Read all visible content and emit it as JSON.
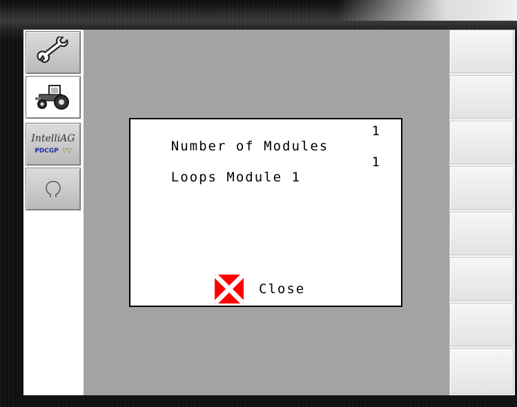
{
  "dialog": {
    "rows": [
      {
        "label": "Number of Modules",
        "value": "1"
      },
      {
        "label": "Loops Module 1",
        "value": "1"
      }
    ],
    "close_label": "Close"
  },
  "left_menu": {
    "items": [
      {
        "icon": "wrench-icon",
        "selected": false
      },
      {
        "icon": "tractor-icon",
        "selected": true
      },
      {
        "icon": "intelliag-logo",
        "selected": false,
        "logo_text": "IntelliAG",
        "logo_sub": "PDCGP",
        "logo_mark": "▽▽"
      },
      {
        "icon": "sprayer-nozzle-icon",
        "selected": false
      }
    ]
  },
  "colors": {
    "screen_bg": "#a3a3a3",
    "dialog_bg": "#ffffff",
    "close_icon": "#ff0000",
    "soft_key": "#efefef"
  }
}
